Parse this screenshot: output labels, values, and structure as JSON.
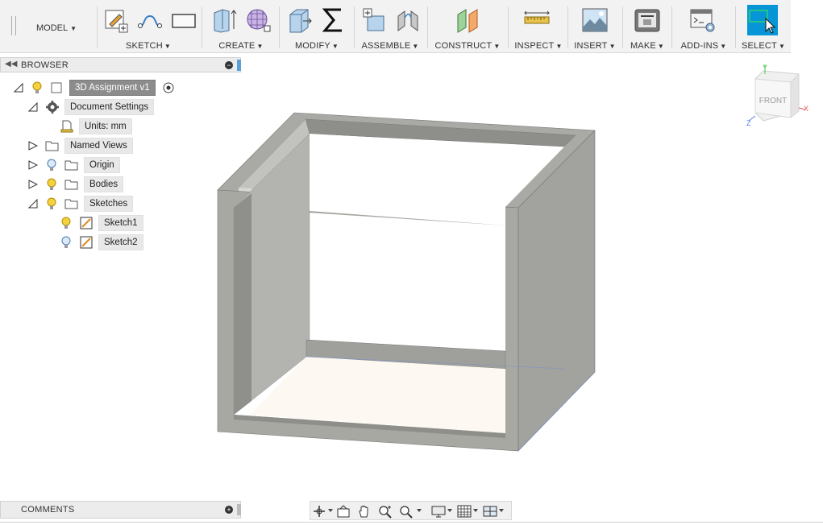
{
  "workspace": {
    "label": "MODEL"
  },
  "toolbar": {
    "groups": [
      {
        "id": "sketch",
        "label": "SKETCH"
      },
      {
        "id": "create",
        "label": "CREATE"
      },
      {
        "id": "modify",
        "label": "MODIFY"
      },
      {
        "id": "assemble",
        "label": "ASSEMBLE"
      },
      {
        "id": "construct",
        "label": "CONSTRUCT"
      },
      {
        "id": "inspect",
        "label": "INSPECT"
      },
      {
        "id": "insert",
        "label": "INSERT"
      },
      {
        "id": "make",
        "label": "MAKE"
      },
      {
        "id": "addins",
        "label": "ADD-INS"
      },
      {
        "id": "select",
        "label": "SELECT"
      }
    ]
  },
  "browser": {
    "title": "BROWSER",
    "nodes": [
      {
        "label": "3D Assignment v1"
      },
      {
        "label": "Document Settings"
      },
      {
        "label": "Units: mm"
      },
      {
        "label": "Named Views"
      },
      {
        "label": "Origin"
      },
      {
        "label": "Bodies"
      },
      {
        "label": "Sketches"
      },
      {
        "label": "Sketch1"
      },
      {
        "label": "Sketch2"
      }
    ]
  },
  "comments": {
    "title": "COMMENTS"
  },
  "viewcube": {
    "face": "FRONT",
    "axes": {
      "x": "X",
      "y": "Y",
      "z": "Z"
    }
  },
  "colors": {
    "accent": "#0696d7",
    "selected_node": "#8c8c8c",
    "model_gray": "#a7a8a2"
  }
}
